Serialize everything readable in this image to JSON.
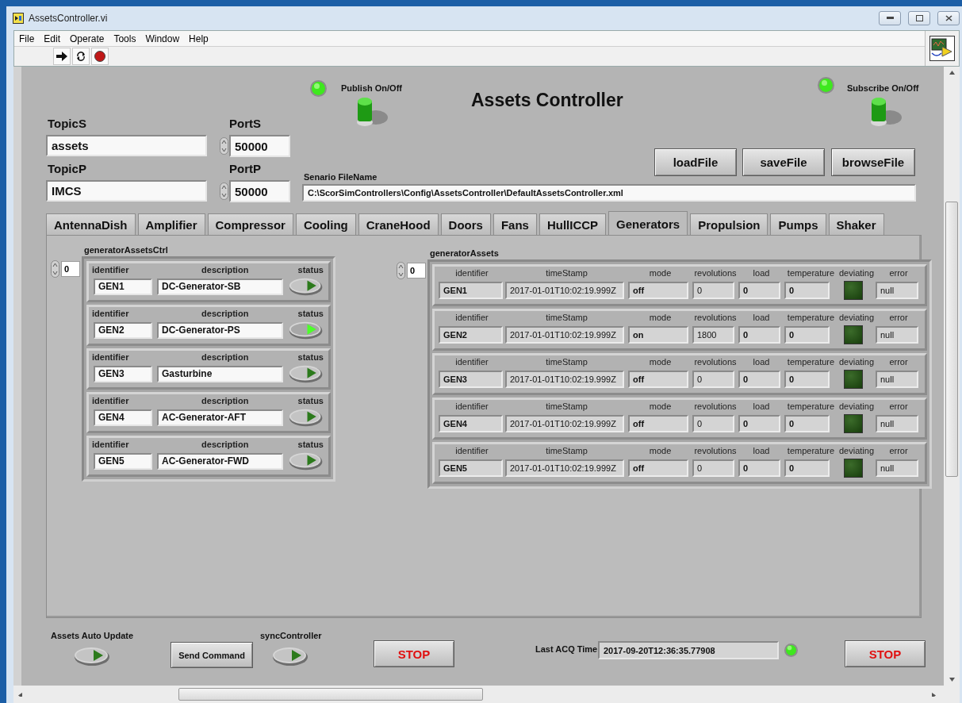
{
  "window": {
    "title": "AssetsController.vi"
  },
  "menu": [
    "File",
    "Edit",
    "Operate",
    "Tools",
    "Window",
    "Help"
  ],
  "panel_title": "Assets Controller",
  "publish": {
    "label": "Publish On/Off",
    "led_on": true,
    "switch_on": true
  },
  "subscribe": {
    "label": "Subscribe On/Off",
    "led_on": true,
    "switch_on": true
  },
  "topic_s": {
    "label": "TopicS",
    "value": "assets"
  },
  "port_s": {
    "label": "PortS",
    "value": "50000"
  },
  "topic_p": {
    "label": "TopicP",
    "value": "IMCS"
  },
  "port_p": {
    "label": "PortP",
    "value": "50000"
  },
  "file_buttons": [
    "loadFile",
    "saveFile",
    "browseFile"
  ],
  "scenario_file": {
    "label": "Senario FileName",
    "value": "C:\\ScorSimControllers\\Config\\AssetsController\\DefaultAssetsController.xml"
  },
  "tabs": [
    {
      "label": "AntennaDish",
      "selected": false
    },
    {
      "label": "Amplifier",
      "selected": false
    },
    {
      "label": "Compressor",
      "selected": false
    },
    {
      "label": "Cooling",
      "selected": false
    },
    {
      "label": "CraneHood",
      "selected": false
    },
    {
      "label": "Doors",
      "selected": false
    },
    {
      "label": "Fans",
      "selected": false
    },
    {
      "label": "HullICCP",
      "selected": false
    },
    {
      "label": "Generators",
      "selected": true
    },
    {
      "label": "Propulsion",
      "selected": false
    },
    {
      "label": "Pumps",
      "selected": false
    },
    {
      "label": "Shaker",
      "selected": false
    }
  ],
  "generator_assets_ctrl": {
    "label": "generatorAssetsCtrl",
    "index": "0",
    "rows": [
      {
        "labels": [
          "identifier",
          "description",
          "status"
        ],
        "identifier": "GEN1",
        "description": "DC-Generator-SB",
        "on": false
      },
      {
        "labels": [
          "identifier",
          "description",
          "status"
        ],
        "identifier": "GEN2",
        "description": "DC-Generator-PS",
        "on": true
      },
      {
        "labels": [
          "identifier",
          "description",
          "status"
        ],
        "identifier": "GEN3",
        "description": "Gasturbine",
        "on": false
      },
      {
        "labels": [
          "identifier",
          "description",
          "status"
        ],
        "identifier": "GEN4",
        "description": "AC-Generator-AFT",
        "on": false
      },
      {
        "labels": [
          "identifier",
          "description",
          "status"
        ],
        "identifier": "GEN5",
        "description": "AC-Generator-FWD",
        "on": false
      }
    ]
  },
  "generator_assets": {
    "label": "generatorAssets",
    "index": "0",
    "rows": [
      {
        "labels": [
          "identifier",
          "timeStamp",
          "mode",
          "revolutions",
          "load",
          "temperature",
          "deviating",
          "error"
        ],
        "values": [
          "GEN1",
          "2017-01-01T10:02:19.999Z",
          "off",
          "0",
          "0",
          "0",
          "null"
        ],
        "deviating": false
      },
      {
        "labels": [
          "identifier",
          "timeStamp",
          "mode",
          "revolutions",
          "load",
          "temperature",
          "deviating",
          "error"
        ],
        "values": [
          "GEN2",
          "2017-01-01T10:02:19.999Z",
          "on",
          "1800",
          "0",
          "0",
          "null"
        ],
        "deviating": false
      },
      {
        "labels": [
          "identifier",
          "timeStamp",
          "mode",
          "revolutions",
          "load",
          "temperature",
          "deviating",
          "error"
        ],
        "values": [
          "GEN3",
          "2017-01-01T10:02:19.999Z",
          "off",
          "0",
          "0",
          "0",
          "null"
        ],
        "deviating": false
      },
      {
        "labels": [
          "identifier",
          "timeStamp",
          "mode",
          "revolutions",
          "load",
          "temperature",
          "deviating",
          "error"
        ],
        "values": [
          "GEN4",
          "2017-01-01T10:02:19.999Z",
          "off",
          "0",
          "0",
          "0",
          "null"
        ],
        "deviating": false
      },
      {
        "labels": [
          "identifier",
          "timeStamp",
          "mode",
          "revolutions",
          "load",
          "temperature",
          "deviating",
          "error"
        ],
        "values": [
          "GEN5",
          "2017-01-01T10:02:19.999Z",
          "off",
          "0",
          "0",
          "0",
          "null"
        ],
        "deviating": false
      }
    ]
  },
  "auto_update": {
    "label": "Assets Auto Update",
    "on": false
  },
  "send_command": "Send Command",
  "sync_controller": {
    "label": "syncController",
    "on": false
  },
  "stop_buttons": [
    "STOP",
    "STOP"
  ],
  "last_acq": {
    "label": "Last ACQ Time",
    "value": "2017-09-20T12:36:35.77908",
    "led_on": true
  }
}
